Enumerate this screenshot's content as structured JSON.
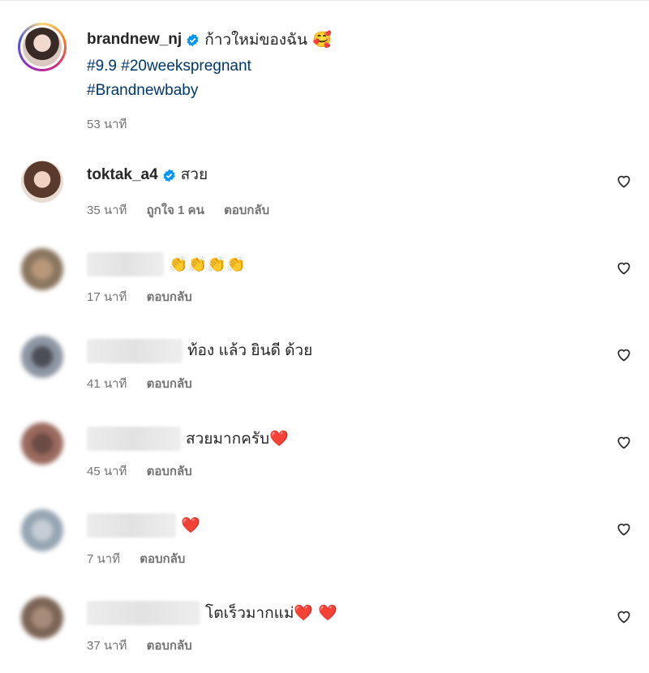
{
  "post": {
    "username": "brandnew_nj",
    "caption": "ก้าวใหม่ของฉัน 🥰",
    "hashtags_line1": "#9.9 #20weekspregnant",
    "hashtags_line2": "#Brandnewbaby",
    "time": "53 นาที"
  },
  "comments": [
    {
      "username": "toktak_a4",
      "text": "สวย",
      "time": "35 นาที",
      "likes": "ถูกใจ 1 คน",
      "reply": "ตอบกลับ"
    },
    {
      "text": "👏👏👏👏",
      "time": "17 นาที",
      "reply": "ตอบกลับ"
    },
    {
      "text": "ท้อง แล้ว ยินดี ด้วย",
      "time": "41 นาที",
      "reply": "ตอบกลับ"
    },
    {
      "text": "สวยมากครับ❤️",
      "time": "45 นาที",
      "reply": "ตอบกลับ"
    },
    {
      "text": "❤️",
      "time": "7 นาที",
      "reply": "ตอบกลับ"
    },
    {
      "text": "โตเร็วมากแม่❤️ ❤️",
      "time": "37 นาที",
      "reply": "ตอบกลับ"
    }
  ],
  "icons": {
    "verified": "verified-badge-icon",
    "like": "heart-outline-icon"
  },
  "colors": {
    "hashtag": "#00376b",
    "verified": "#0095f6",
    "meta": "#737373"
  }
}
